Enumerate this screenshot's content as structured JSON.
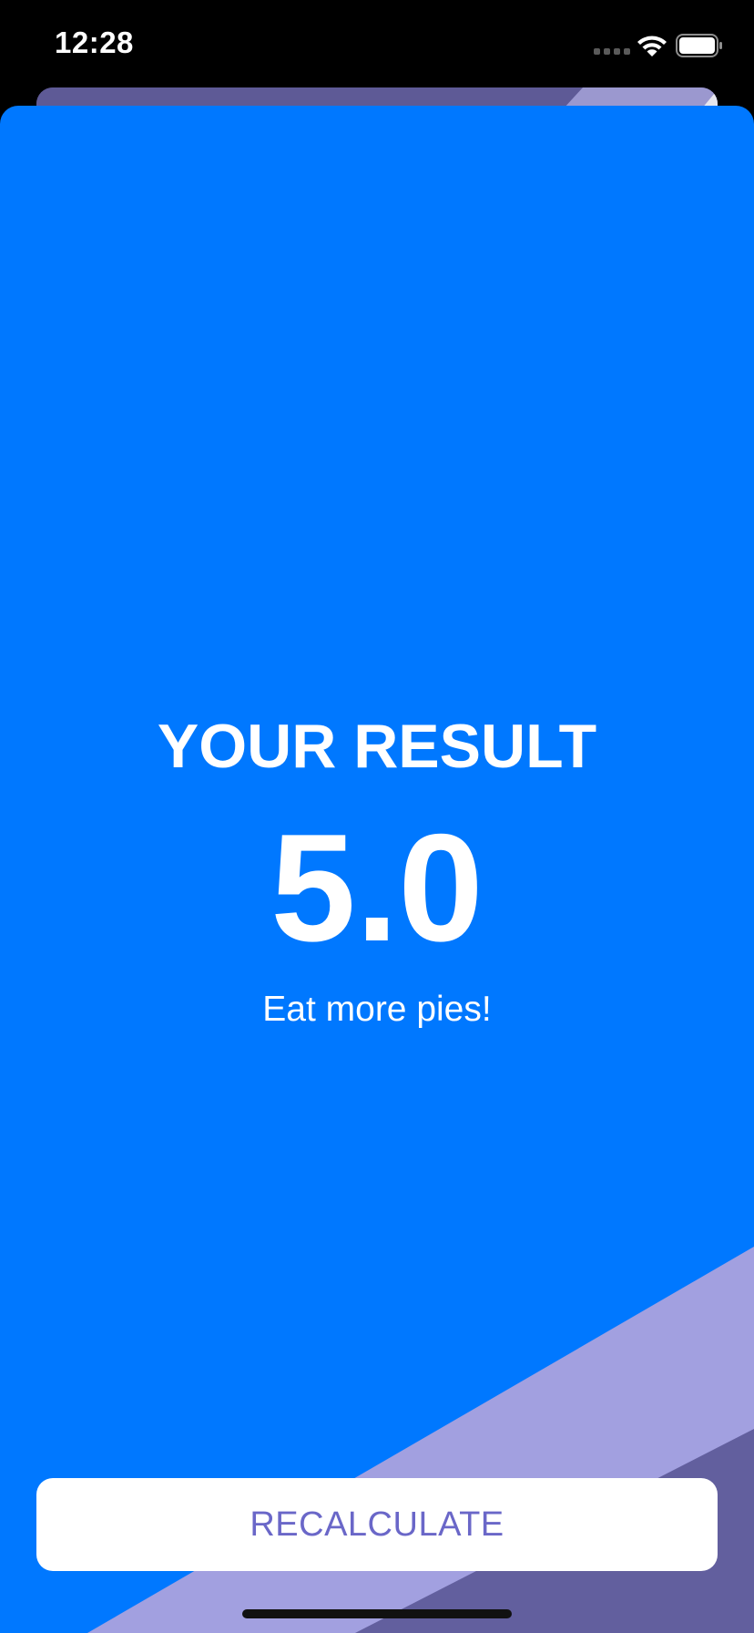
{
  "status_bar": {
    "time": "12:28"
  },
  "result": {
    "title": "YOUR RESULT",
    "value": "5.0",
    "advice": "Eat more pies!"
  },
  "actions": {
    "recalculate_label": "RECALCULATE"
  },
  "colors": {
    "sheet_background": "#0078ff",
    "stripe_light": "#a2a0e0",
    "stripe_dark": "#625f9e",
    "button_background": "#ffffff",
    "button_text": "#6a67c8"
  }
}
